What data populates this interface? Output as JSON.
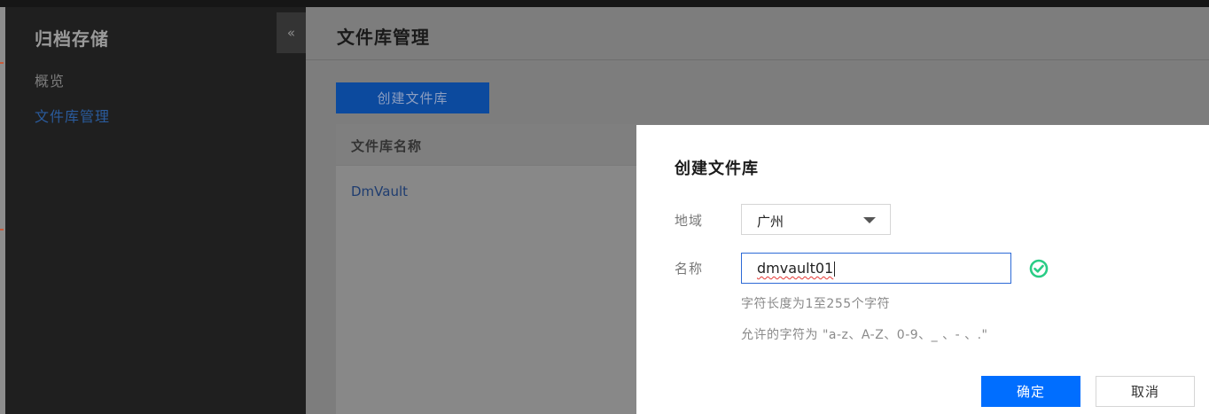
{
  "sidebar": {
    "title": "归档存储",
    "items": [
      {
        "label": "概览"
      },
      {
        "label": "文件库管理"
      }
    ],
    "collapse_glyph": "«",
    "active_color": "#2a5b9c"
  },
  "main": {
    "page_title": "文件库管理",
    "create_button_label": "创建文件库",
    "table": {
      "columns": [
        "文件库名称"
      ],
      "rows": [
        {
          "name": "DmVault"
        }
      ]
    }
  },
  "modal": {
    "title": "创建文件库",
    "region": {
      "label": "地域",
      "value": "广州"
    },
    "name": {
      "label": "名称",
      "value": "dmvault01"
    },
    "valid_icon": "check-circle-icon",
    "hints": [
      "字符长度为1至255个字符",
      "允许的字符为 \"a-z、A-Z、0-9、_ 、- 、.\""
    ],
    "ok_label": "确定",
    "cancel_label": "取消",
    "primary_color": "#006eff",
    "success_color": "#29cc85"
  }
}
